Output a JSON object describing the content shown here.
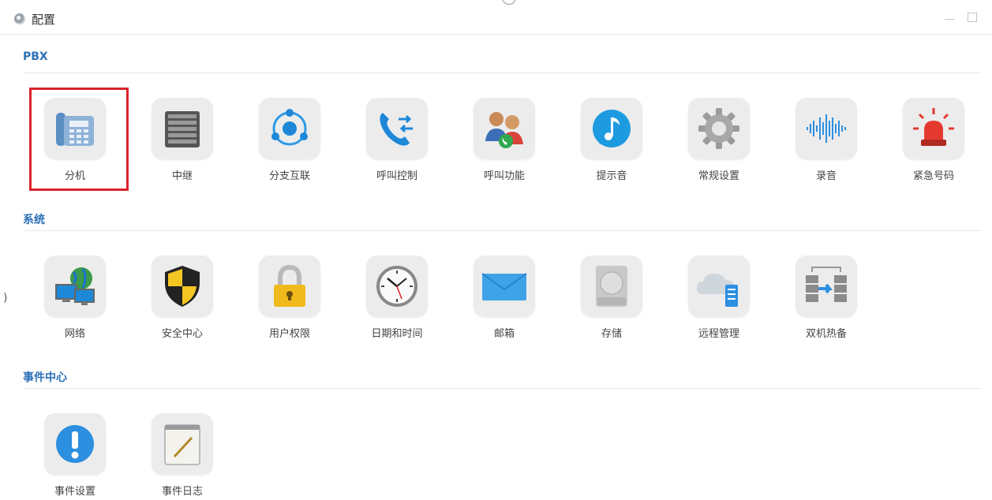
{
  "window": {
    "title": "配置"
  },
  "sections": {
    "pbx": {
      "title": "PBX",
      "items": [
        {
          "label": "分机",
          "icon": "desk-phone-icon"
        },
        {
          "label": "中继",
          "icon": "server-rack-icon"
        },
        {
          "label": "分支互联",
          "icon": "network-nodes-icon"
        },
        {
          "label": "呼叫控制",
          "icon": "call-transfer-icon"
        },
        {
          "label": "呼叫功能",
          "icon": "users-phone-icon"
        },
        {
          "label": "提示音",
          "icon": "music-note-icon"
        },
        {
          "label": "常规设置",
          "icon": "gear-icon"
        },
        {
          "label": "录音",
          "icon": "sound-wave-icon"
        },
        {
          "label": "紧急号码",
          "icon": "alarm-siren-icon"
        }
      ]
    },
    "system": {
      "title": "系统",
      "items": [
        {
          "label": "网络",
          "icon": "globe-computers-icon"
        },
        {
          "label": "安全中心",
          "icon": "security-shield-icon"
        },
        {
          "label": "用户权限",
          "icon": "padlock-icon"
        },
        {
          "label": "日期和时间",
          "icon": "clock-icon"
        },
        {
          "label": "邮箱",
          "icon": "envelope-icon"
        },
        {
          "label": "存储",
          "icon": "hard-disk-icon"
        },
        {
          "label": "远程管理",
          "icon": "cloud-server-icon"
        },
        {
          "label": "双机热备",
          "icon": "server-sync-icon"
        }
      ]
    },
    "events": {
      "title": "事件中心",
      "items": [
        {
          "label": "事件设置",
          "icon": "alert-icon"
        },
        {
          "label": "事件日志",
          "icon": "notepad-icon"
        }
      ]
    }
  },
  "selected_item": "分机",
  "colors": {
    "accent": "#2d70b7",
    "selection": "#d9232a"
  }
}
